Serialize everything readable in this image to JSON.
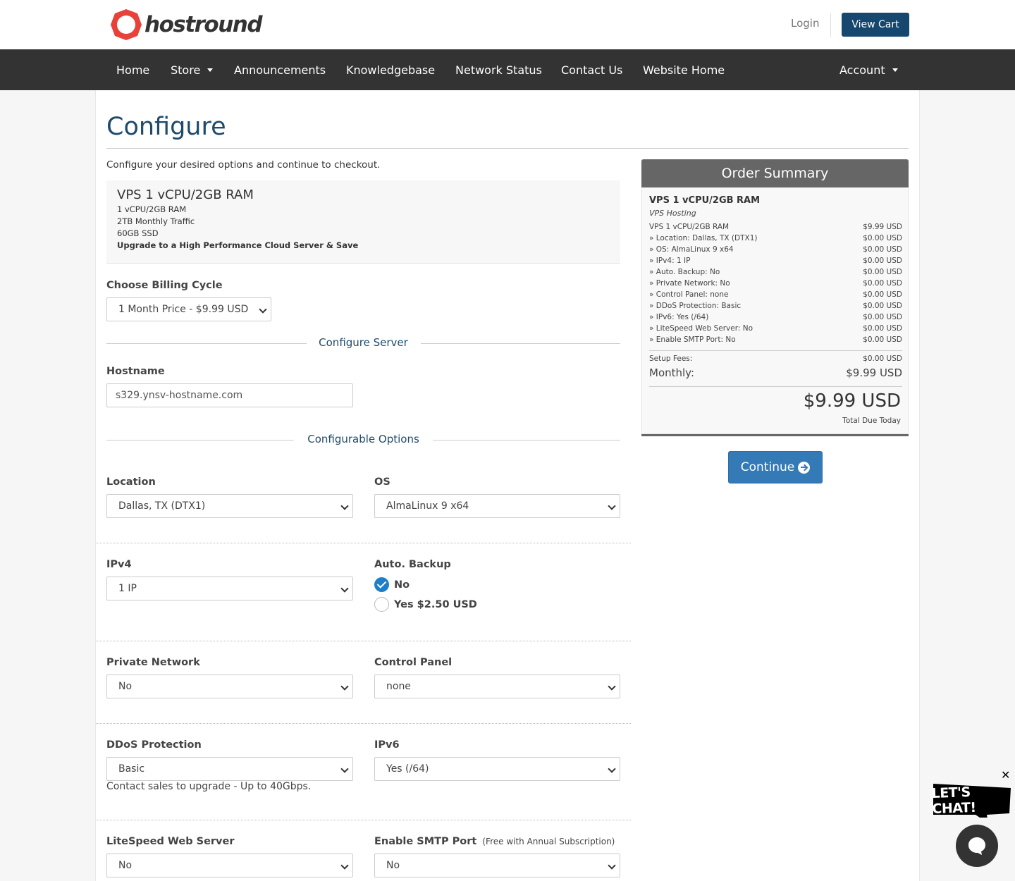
{
  "brand": {
    "logo_text": "hostround",
    "brand_color": "#e8413a"
  },
  "header": {
    "login_label": "Login",
    "view_cart_label": "View Cart"
  },
  "nav": {
    "home": "Home",
    "store": "Store",
    "announcements": "Announcements",
    "knowledgebase": "Knowledgebase",
    "network_status": "Network Status",
    "contact_us": "Contact Us",
    "website_home": "Website Home",
    "account": "Account"
  },
  "page": {
    "title": "Configure",
    "intro": "Configure your desired options and continue to checkout."
  },
  "product": {
    "name": "VPS 1 vCPU/2GB RAM",
    "lines": [
      "1 vCPU/2GB RAM",
      "2TB Monthly Traffic",
      "60GB SSD"
    ],
    "upgrade_note": "Upgrade to a High Performance Cloud Server & Save"
  },
  "billing": {
    "label": "Choose Billing Cycle",
    "selected": "1 Month Price - $9.99 USD"
  },
  "sections": {
    "configure_server": "Configure Server",
    "configurable_options": "Configurable Options"
  },
  "hostname": {
    "label": "Hostname",
    "value": "s329.ynsv-hostname.com"
  },
  "options": {
    "location": {
      "label": "Location",
      "selected": "Dallas, TX (DTX1)"
    },
    "os": {
      "label": "OS",
      "selected": "AlmaLinux 9 x64"
    },
    "ipv4": {
      "label": "IPv4",
      "selected": "1 IP"
    },
    "auto_backup": {
      "label": "Auto. Backup",
      "option_no": "No",
      "option_yes": "Yes $2.50 USD"
    },
    "private_network": {
      "label": "Private Network",
      "selected": "No"
    },
    "control_panel": {
      "label": "Control Panel",
      "selected": "none"
    },
    "ddos": {
      "label": "DDoS Protection",
      "selected": "Basic",
      "help": "Contact sales to upgrade - Up to 40Gbps."
    },
    "ipv6": {
      "label": "IPv6",
      "selected": "Yes (/64)"
    },
    "litespeed": {
      "label": "LiteSpeed Web Server",
      "selected": "No"
    },
    "smtp": {
      "label": "Enable SMTP Port",
      "note": "(Free with Annual Subscription)",
      "selected": "No"
    }
  },
  "summary": {
    "heading": "Order Summary",
    "product": "VPS 1 vCPU/2GB RAM",
    "group": "VPS Hosting",
    "lines": [
      {
        "label": "VPS 1 vCPU/2GB RAM",
        "price": "$9.99 USD"
      },
      {
        "label": "» Location: Dallas, TX (DTX1)",
        "price": "$0.00 USD"
      },
      {
        "label": "» OS: AlmaLinux 9 x64",
        "price": "$0.00 USD"
      },
      {
        "label": "» IPv4: 1 IP",
        "price": "$0.00 USD"
      },
      {
        "label": "» Auto. Backup: No",
        "price": "$0.00 USD"
      },
      {
        "label": "» Private Network: No",
        "price": "$0.00 USD"
      },
      {
        "label": "» Control Panel: none",
        "price": "$0.00 USD"
      },
      {
        "label": "» DDoS Protection: Basic",
        "price": "$0.00 USD"
      },
      {
        "label": "» IPv6: Yes (/64)",
        "price": "$0.00 USD"
      },
      {
        "label": "» LiteSpeed Web Server: No",
        "price": "$0.00 USD"
      },
      {
        "label": "» Enable SMTP Port: No",
        "price": "$0.00 USD"
      }
    ],
    "setup_label": "Setup Fees:",
    "setup_value": "$0.00 USD",
    "monthly_label": "Monthly:",
    "monthly_value": "$9.99 USD",
    "total": "$9.99 USD",
    "total_label": "Total Due Today"
  },
  "continue_label": "Continue",
  "chat": {
    "bubble_text": "LET'S CHAT!",
    "close": "✕"
  }
}
